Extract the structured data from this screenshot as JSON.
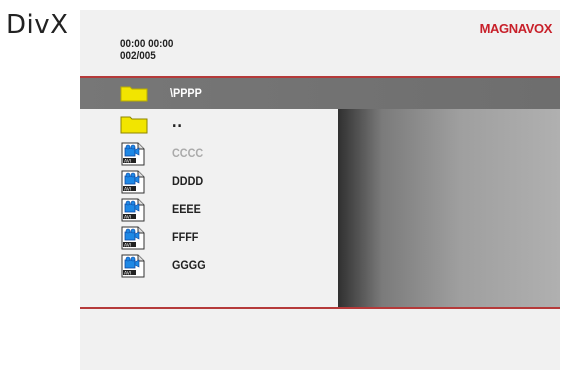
{
  "side_label": "DivX",
  "header": {
    "time": "00:00  00:00",
    "track_count": "002/005",
    "brand": "MAGNAVOX"
  },
  "path": "\\PPPP",
  "items": [
    {
      "label": "..",
      "icon": "folder-icon",
      "dim": false
    },
    {
      "label": "CCCC",
      "icon": "video-file-icon",
      "dim": true
    },
    {
      "label": "DDDD",
      "icon": "video-file-icon",
      "dim": false
    },
    {
      "label": "EEEE",
      "icon": "video-file-icon",
      "dim": false
    },
    {
      "label": "FFFF",
      "icon": "video-file-icon",
      "dim": false
    },
    {
      "label": "GGGG",
      "icon": "video-file-icon",
      "dim": false
    }
  ],
  "colors": {
    "brand": "#c8202a",
    "accent_line": "#b53a3a",
    "path_bar": "#777777",
    "folder": "#f2e500"
  }
}
